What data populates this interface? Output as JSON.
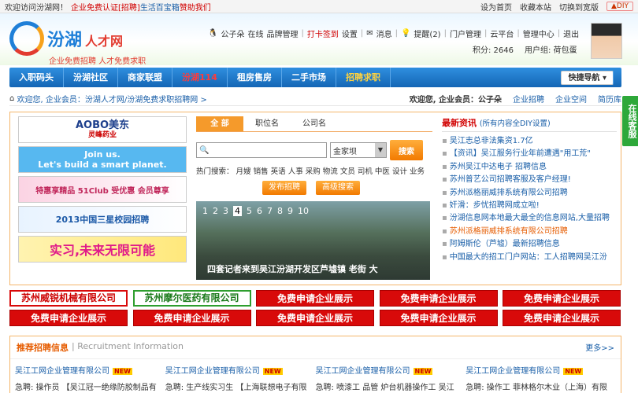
{
  "topbar": {
    "welcome": "欢迎访问汾湖网！",
    "cert": "企业免费认证[招聘]",
    "life": "生活百宝箱",
    "help": "赞助我们",
    "home": "设为首页",
    "fav": "收藏本站",
    "wide": "切换到宽版",
    "diy": "▲DIY"
  },
  "logo": {
    "title": "汾湖",
    "sub": "人才网",
    "slogan": "企业免费招聘 人才免费求职"
  },
  "userbar": {
    "user": "公子朵",
    "online": "在线",
    "brand": "品牌管理",
    "checkin": "打卡签到",
    "settings": "设置",
    "messages": "消息",
    "remind": "提醒(2)",
    "portal": "门户管理",
    "cloud": "云平台",
    "admin": "管理中心",
    "logout": "退出",
    "points": "积分: 2646",
    "group": "用户组: 荷包蛋"
  },
  "nav": [
    "入职码头",
    "汾湖社区",
    "商家联盟",
    "汾湖114",
    "租房售房",
    "二手市场",
    "招聘求职"
  ],
  "quicknav": "快捷导航 ▾",
  "crumb": {
    "text": "欢迎您, 企业会员：汾湖人才网/汾湖免费求职招聘网 >",
    "welcome": "欢迎您, 企业会员：公子朵",
    "ent_recruit": "企业招聘",
    "ent_space": "企业空间",
    "resume": "简历库"
  },
  "side": "在线客服",
  "ads": {
    "a1": "AOBO美东",
    "a1sub": "灵峰药业",
    "a2": "Join us.",
    "a2sub": "Let's build a smart planet.",
    "a3": "特惠享精品 51Club 受优惠 会员尊享",
    "a4": "2013中国三星校园招聘",
    "a5": "实习,未来无限可能"
  },
  "search": {
    "tabs": [
      "全 部",
      "职位名",
      "公司名"
    ],
    "region": "金家坝",
    "btn": "搜索",
    "hot_label": "热门搜索：",
    "hot": [
      "月嫂",
      "销售",
      "英语",
      "人事",
      "采购",
      "物流",
      "文员",
      "司机",
      "中医",
      "设计",
      "业务"
    ],
    "post": "发布招聘",
    "adv": "高级搜索"
  },
  "photo": {
    "nums": [
      "1",
      "2",
      "3",
      "4",
      "5",
      "6",
      "7",
      "8",
      "9",
      "10"
    ],
    "caption": "四套记者来到吴江汾湖开发区芦墟镇 老街 大"
  },
  "news": {
    "title": "最新资讯",
    "sub": "(所有内容全DIY设置)",
    "items": [
      "吴江志总非法集资1.7亿",
      "【资讯】吴江服务行业年前遭遇\"用工荒\"",
      "苏州吴江中达电子 招聘信息",
      "苏州普艺公司招聘客服及客户经理!",
      "苏州派格丽威排系统有限公司招聘",
      "奸滑：步忧招聘网成立啦!",
      "汾湖信息网本地最大最全的信息网站,大量招聘",
      "苏州派格丽威排系统有限公司招聘",
      "阿姆斯伦（芦墟）最新招聘信息",
      "中国最大的招工门户网站：工人招聘网吴江汾"
    ]
  },
  "companies": [
    "苏州威锐机械有限公司",
    "苏州摩尔医药有限公司",
    "免费申请企业展示",
    "免费申请企业展示",
    "免费申请企业展示",
    "免费申请企业展示",
    "免费申请企业展示",
    "免费申请企业展示",
    "免费申请企业展示",
    "免费申请企业展示"
  ],
  "recommend": {
    "title": "推荐招聘信息",
    "sub": "| Recruitment Information",
    "more": "更多>>",
    "new": "NEW",
    "cols": [
      {
        "t": "吴江工网企业管理有限公司",
        "d": "急聘: 操作员 【吴江冠一绝缘防胶制品有"
      },
      {
        "t": "吴江工网企业管理有限公司",
        "d": "急聘: 生产线实习生 【上海联想电子有限"
      },
      {
        "t": "吴江工网企业管理有限公司",
        "d": "急聘: 喷漆工 品管 炉台机器操作工 吴江"
      },
      {
        "t": "吴江工网企业管理有限公司",
        "d": "急聘: 操作工 菲林格尔木业（上海）有限"
      }
    ]
  }
}
